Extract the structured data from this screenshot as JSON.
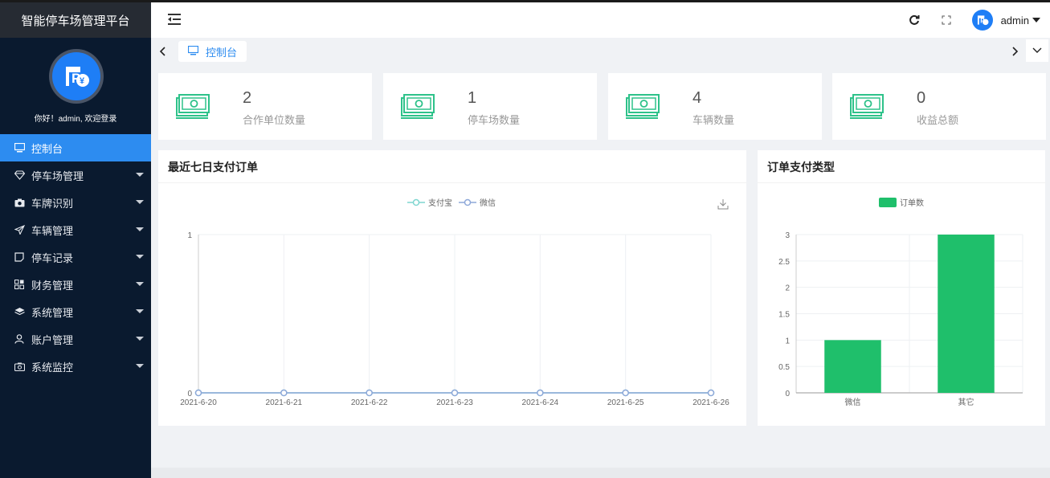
{
  "app": {
    "title": "智能停车场管理平台",
    "welcome": "你好！admin, 欢迎登录"
  },
  "sidebar": {
    "items": [
      {
        "label": "控制台",
        "icon": "monitor-icon",
        "active": true
      },
      {
        "label": "停车场管理",
        "icon": "diamond-icon"
      },
      {
        "label": "车牌识别",
        "icon": "camera-icon"
      },
      {
        "label": "车辆管理",
        "icon": "send-icon"
      },
      {
        "label": "停车记录",
        "icon": "note-icon"
      },
      {
        "label": "财务管理",
        "icon": "grid-icon"
      },
      {
        "label": "系统管理",
        "icon": "layers-icon"
      },
      {
        "label": "账户管理",
        "icon": "user-icon"
      },
      {
        "label": "系统监控",
        "icon": "camera-icon"
      }
    ]
  },
  "header": {
    "username": "admin"
  },
  "tabs": [
    {
      "label": "控制台",
      "icon": "monitor-icon"
    }
  ],
  "stats": [
    {
      "value": "2",
      "label": "合作单位数量"
    },
    {
      "value": "1",
      "label": "停车场数量"
    },
    {
      "value": "4",
      "label": "车辆数量"
    },
    {
      "value": "0",
      "label": "收益总额"
    }
  ],
  "colors": {
    "accent": "#2d8cf0",
    "green": "#1fbf6b",
    "sidebar": "#0a1a2f",
    "money": "#2ec28a"
  },
  "chart_data": [
    {
      "type": "line",
      "title": "最近七日支付订单",
      "x": [
        "2021-6-20",
        "2021-6-21",
        "2021-6-22",
        "2021-6-23",
        "2021-6-24",
        "2021-6-25",
        "2021-6-26"
      ],
      "series": [
        {
          "name": "支付宝",
          "values": [
            0,
            0,
            0,
            0,
            0,
            0,
            0
          ],
          "color": "#7fd6d0"
        },
        {
          "name": "微信",
          "values": [
            0,
            0,
            0,
            0,
            0,
            0,
            0
          ],
          "color": "#8ea8d9"
        }
      ],
      "yticks": [
        "0",
        "1"
      ],
      "ylim": [
        0,
        1
      ],
      "legend": "top-center",
      "grid": true
    },
    {
      "type": "bar",
      "title": "订单支付类型",
      "categories": [
        "微信",
        "其它"
      ],
      "series": [
        {
          "name": "订单数",
          "values": [
            1,
            3
          ],
          "color": "#1fbf6b"
        }
      ],
      "yticks": [
        "0",
        "0.5",
        "1",
        "1.5",
        "2",
        "2.5",
        "3"
      ],
      "ylim": [
        0,
        3
      ],
      "legend": "top-center",
      "grid": true
    }
  ]
}
